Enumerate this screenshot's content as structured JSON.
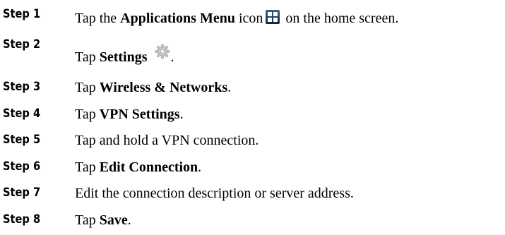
{
  "steps": [
    {
      "label": "Step 1",
      "parts": {
        "a": "Tap the ",
        "b": "Applications Menu",
        "c": " icon",
        "d": " on the home screen."
      }
    },
    {
      "label": "Step 2",
      "parts": {
        "a": "Tap ",
        "b": "Settings",
        "c": " ",
        "d": "."
      }
    },
    {
      "label": "Step 3",
      "parts": {
        "a": "Tap ",
        "b": "Wireless & Networks",
        "c": "."
      }
    },
    {
      "label": "Step 4",
      "parts": {
        "a": "Tap ",
        "b": "VPN Settings",
        "c": "."
      }
    },
    {
      "label": "Step 5",
      "parts": {
        "a": "Tap and hold a VPN connection."
      }
    },
    {
      "label": "Step 6",
      "parts": {
        "a": "Tap ",
        "b": "Edit Connection",
        "c": "."
      }
    },
    {
      "label": "Step 7",
      "parts": {
        "a": "Edit the connection description or server address."
      }
    },
    {
      "label": "Step 8",
      "parts": {
        "a": "Tap ",
        "b": "Save",
        "c": "."
      }
    }
  ],
  "icons": {
    "applications_menu": "applications-menu-icon",
    "settings": "settings-gear-icon"
  },
  "colors": {
    "text": "#000000",
    "apps_icon_bg": "#1a3a5c"
  }
}
